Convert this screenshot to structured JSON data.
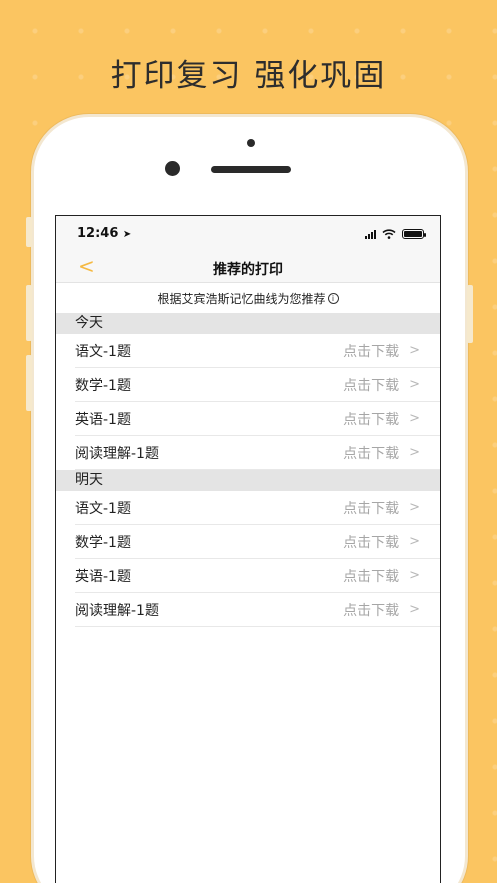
{
  "headline": "打印复习 强化巩固",
  "status_bar": {
    "time": "12:46",
    "location_icon": "location-arrow-icon",
    "icons": [
      "signal-icon",
      "wifi-icon",
      "battery-icon"
    ]
  },
  "nav": {
    "back_icon": "chevron-left-icon",
    "back_glyph": "<",
    "title": "推荐的打印"
  },
  "subtitle": "根据艾宾浩斯记忆曲线为您推荐",
  "info_icon": "i",
  "sections": [
    {
      "header": "今天",
      "items": [
        {
          "label": "语文-1题",
          "action": "点击下载"
        },
        {
          "label": "数学-1题",
          "action": "点击下载"
        },
        {
          "label": "英语-1题",
          "action": "点击下载"
        },
        {
          "label": "阅读理解-1题",
          "action": "点击下载"
        }
      ]
    },
    {
      "header": "明天",
      "items": [
        {
          "label": "语文-1题",
          "action": "点击下载"
        },
        {
          "label": "数学-1题",
          "action": "点击下载"
        },
        {
          "label": "英语-1题",
          "action": "点击下载"
        },
        {
          "label": "阅读理解-1题",
          "action": "点击下载"
        }
      ]
    }
  ],
  "chevron_glyph": ">",
  "colors": {
    "background": "#FBC561",
    "accent": "#F5B942",
    "section_header_bg": "#e4e4e4",
    "action_text": "#a6a6a6"
  }
}
